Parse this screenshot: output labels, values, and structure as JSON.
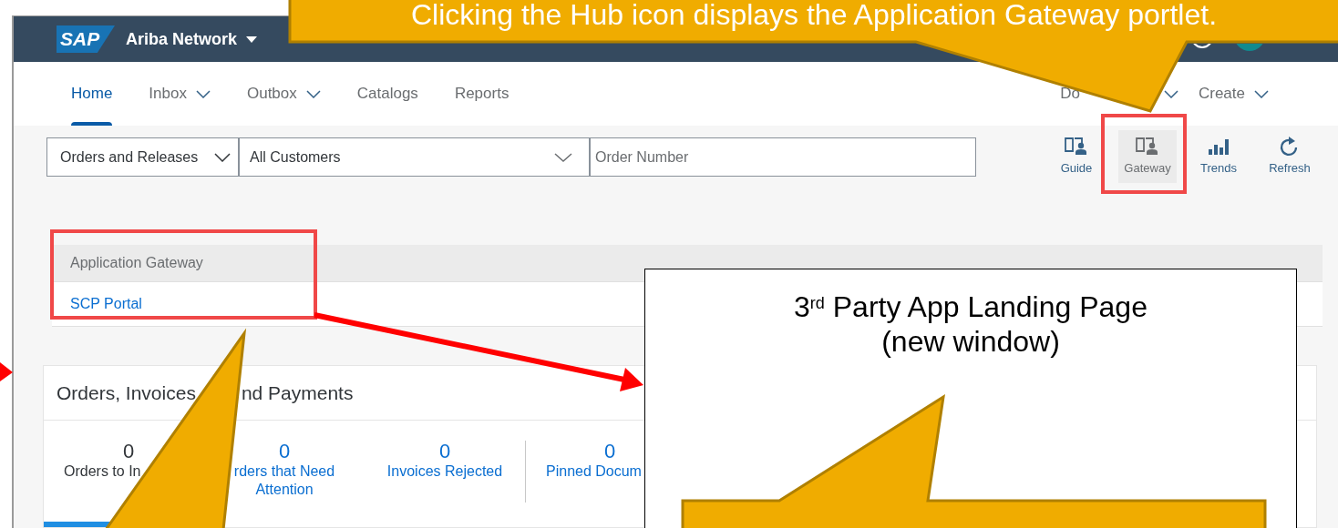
{
  "callout": {
    "text": "Clicking the Hub icon displays the Application Gateway portlet."
  },
  "header": {
    "logo": "SAP",
    "title": "Ariba Network"
  },
  "nav": {
    "items": [
      {
        "label": "Home",
        "selected": true,
        "dropdown": false
      },
      {
        "label": "Inbox",
        "selected": false,
        "dropdown": true
      },
      {
        "label": "Outbox",
        "selected": false,
        "dropdown": true
      },
      {
        "label": "Catalogs",
        "selected": false,
        "dropdown": false
      },
      {
        "label": "Reports",
        "selected": false,
        "dropdown": false
      }
    ],
    "right": [
      {
        "label": "Do",
        "dropdown": true
      },
      {
        "label": "Create",
        "dropdown": true
      }
    ]
  },
  "filters": {
    "document_type": "Orders and Releases",
    "customer": "All Customers",
    "placeholder": "Order Number"
  },
  "tools": [
    {
      "label": "Guide",
      "kind": "guide",
      "selected": false
    },
    {
      "label": "Gateway",
      "kind": "gateway",
      "selected": true
    },
    {
      "label": "Trends",
      "kind": "trends",
      "selected": false
    },
    {
      "label": "Refresh",
      "kind": "refresh",
      "selected": false
    }
  ],
  "portlet": {
    "title": "Application Gateway",
    "links": [
      "SCP Portal"
    ]
  },
  "card": {
    "title_parts": [
      "Orders, Invoices",
      "nd Payments"
    ],
    "tiles": [
      {
        "count": "0",
        "lines": [
          "Orders to In"
        ],
        "selected": true
      },
      {
        "count": "0",
        "lines": [
          "rders that Need",
          "Attention"
        ],
        "selected": false
      },
      {
        "count": "0",
        "lines": [
          "Invoices Rejected"
        ],
        "selected": false
      },
      {
        "count": "0",
        "lines": [
          "Pinned Docum"
        ],
        "selected": false
      }
    ]
  },
  "new_window": {
    "title": "3$^{rd}$ Party App Landing Page",
    "subtitle": "(new window)"
  }
}
